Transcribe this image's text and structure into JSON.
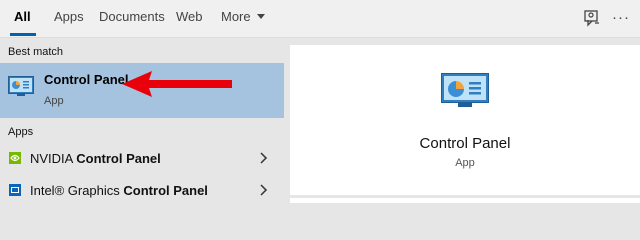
{
  "tabs": {
    "all": "All",
    "apps": "Apps",
    "documents": "Documents",
    "web": "Web",
    "more": "More",
    "more_options": "···"
  },
  "icons": {
    "feedback": "feedback-icon",
    "control_panel": "control-panel-icon",
    "nvidia": "nvidia-icon",
    "intel": "intel-graphics-icon",
    "chevron": "chevron-right-icon"
  },
  "best_match": {
    "section_label": "Best match",
    "title": "Control Panel",
    "subtitle": "App"
  },
  "apps_section": {
    "label": "Apps",
    "items": [
      {
        "prefix": "NVIDIA ",
        "highlight": "Control Panel"
      },
      {
        "prefix": "Intel® Graphics ",
        "highlight": "Control Panel"
      }
    ]
  },
  "preview": {
    "title": "Control Panel",
    "subtitle": "App"
  },
  "colors": {
    "accent": "#0063b1",
    "selection": "#a5c3df",
    "arrow": "#e8000b"
  }
}
